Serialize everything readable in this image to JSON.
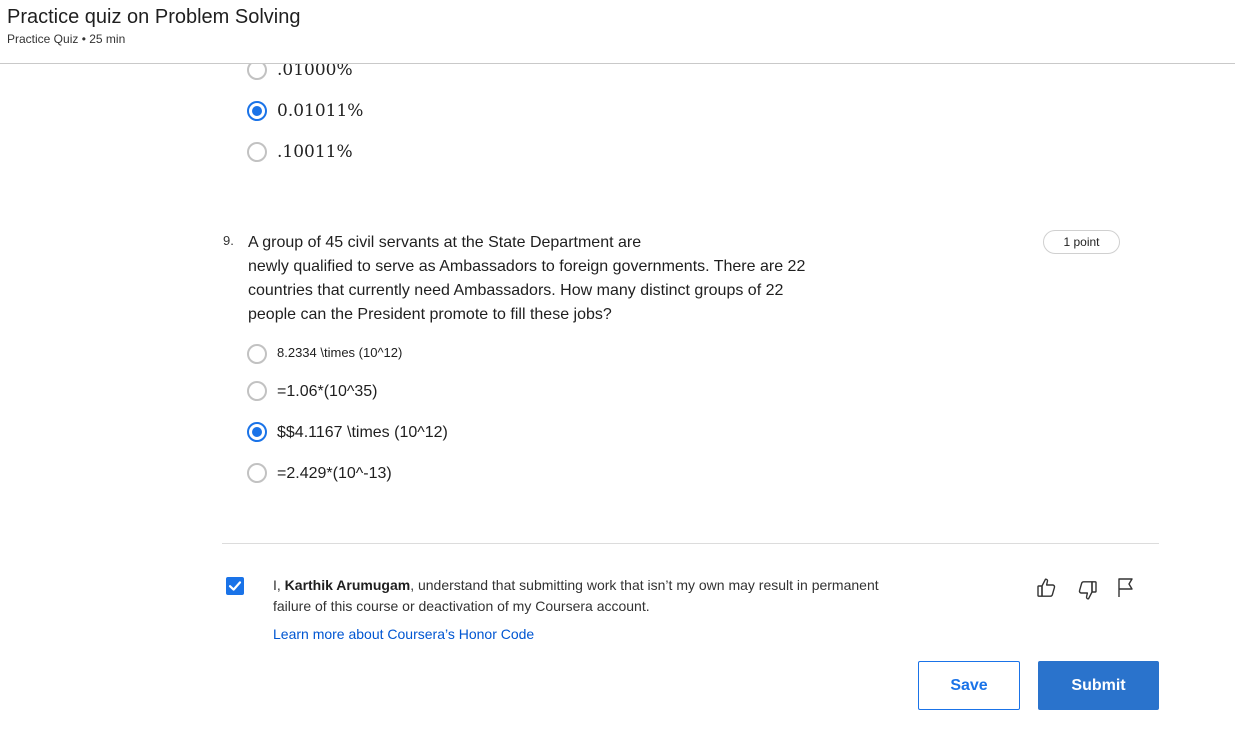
{
  "header": {
    "title": "Practice quiz on Problem Solving",
    "subtitle": "Practice Quiz • 25 min"
  },
  "prev_question": {
    "options": [
      {
        "label": ".01000%",
        "selected": false
      },
      {
        "label": "0.01011%",
        "selected": true
      },
      {
        "label": ".10011%",
        "selected": false
      }
    ]
  },
  "question": {
    "number": "9.",
    "points": "1 point",
    "text_lines": [
      "A group of 45 civil servants at the State Department are",
      "newly qualified to serve as Ambassadors to foreign governments. There are 22",
      "countries that currently need Ambassadors. How many distinct groups of 22",
      "people can the President promote to fill these jobs?"
    ],
    "options": [
      {
        "label": "8.2334 \\times (10^12)",
        "selected": false
      },
      {
        "label": "=1.06*(10^35)",
        "selected": false
      },
      {
        "label": "$$4.1167 \\times (10^12)",
        "selected": true
      },
      {
        "label": "=2.429*(10^-13)",
        "selected": false
      }
    ]
  },
  "honor": {
    "checked": true,
    "prefix": "I, ",
    "name": "Karthik Arumugam",
    "line1_suffix": ", understand that submitting work that isn’t my own may result in permanent",
    "line2": "failure of this course or deactivation of my Coursera account.",
    "link": "Learn more about Coursera’s Honor Code"
  },
  "icons": [
    "thumbs-up-icon",
    "thumbs-down-icon",
    "flag-icon"
  ],
  "buttons": {
    "save": "Save",
    "submit": "Submit"
  },
  "colors": {
    "accent": "#1a73e8",
    "submit_bg": "#2a73cc",
    "link": "#0056d2"
  }
}
